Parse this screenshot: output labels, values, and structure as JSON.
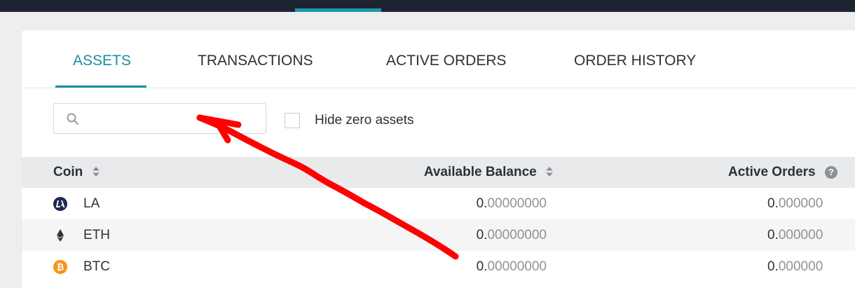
{
  "tabs": [
    {
      "label": "ASSETS",
      "active": true
    },
    {
      "label": "TRANSACTIONS",
      "active": false
    },
    {
      "label": "ACTIVE ORDERS",
      "active": false
    },
    {
      "label": "ORDER HISTORY",
      "active": false
    }
  ],
  "search": {
    "value": "",
    "placeholder": ""
  },
  "filters": {
    "hide_zero_label": "Hide zero assets",
    "hide_zero_checked": false
  },
  "table": {
    "headers": {
      "coin": "Coin",
      "available_balance": "Available Balance",
      "active_orders": "Active Orders"
    },
    "rows": [
      {
        "coin": "LA",
        "icon": "la-coin-icon",
        "balance_int": "0.",
        "balance_dec": "00000000",
        "orders_int": "0.",
        "orders_dec": "000000"
      },
      {
        "coin": "ETH",
        "icon": "eth-coin-icon",
        "balance_int": "0.",
        "balance_dec": "00000000",
        "orders_int": "0.",
        "orders_dec": "000000"
      },
      {
        "coin": "BTC",
        "icon": "btc-coin-icon",
        "balance_int": "0.",
        "balance_dec": "00000000",
        "orders_int": "0.",
        "orders_dec": "000000"
      }
    ]
  },
  "colors": {
    "accent": "#1b8fa0",
    "topbar": "#1d2330",
    "annotation": "#ff0000",
    "btc": "#f7931a",
    "la": "#1c2a4d"
  }
}
